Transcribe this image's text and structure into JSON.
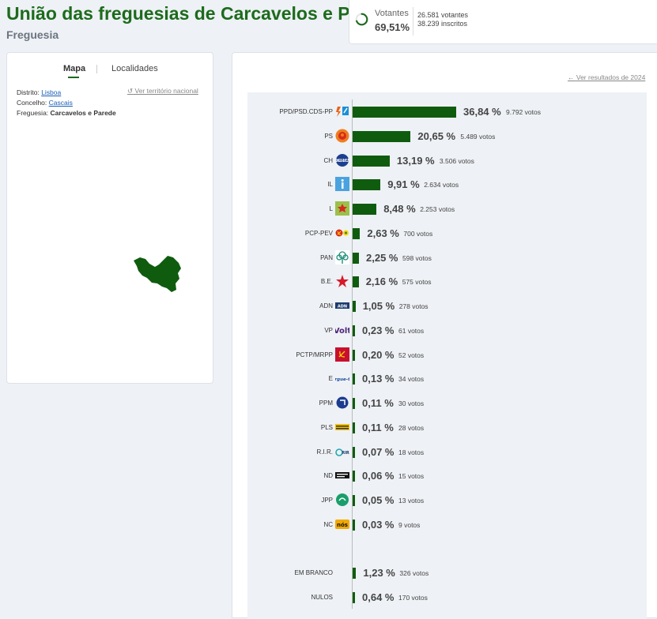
{
  "header": {
    "title": "União das freguesias de Carcavelos e Parede",
    "subtitle": "Freguesia"
  },
  "turnout": {
    "label": "Votantes",
    "percent": "69,51%",
    "percent_value": 69.51,
    "voters": "26.581 votantes",
    "registered": "38.239 inscritos"
  },
  "left_panel": {
    "tabs": [
      {
        "label": "Mapa"
      },
      {
        "label": "Localidades"
      }
    ],
    "distrito_label": "Distrito:",
    "distrito_value": "Lisboa",
    "concelho_label": "Concelho:",
    "concelho_value": "Cascais",
    "freguesia_label": "Freguesia:",
    "freguesia_value": "Carcavelos e Parede",
    "ver_territorio": "Ver território nacional",
    "map_color": "#0f5c0f"
  },
  "results": {
    "ver_resultados": "Ver resultados de 2024",
    "bar_color": "#0f5c0f",
    "parties": [
      {
        "name": "PPD/PSD.CDS-PP",
        "pct": "36,84 %",
        "value": 36.84,
        "votes": "9.792 votos",
        "logo": "psd-cds-logo"
      },
      {
        "name": "PS",
        "pct": "20,65 %",
        "value": 20.65,
        "votes": "5.489 votos",
        "logo": "ps-logo"
      },
      {
        "name": "CH",
        "pct": "13,19 %",
        "value": 13.19,
        "votes": "3.506 votos",
        "logo": "ch-logo"
      },
      {
        "name": "IL",
        "pct": "9,91 %",
        "value": 9.91,
        "votes": "2.634 votos",
        "logo": "il-logo"
      },
      {
        "name": "L",
        "pct": "8,48 %",
        "value": 8.48,
        "votes": "2.253 votos",
        "logo": "livre-logo"
      },
      {
        "name": "PCP-PEV",
        "pct": "2,63 %",
        "value": 2.63,
        "votes": "700 votos",
        "logo": "pcp-pev-logo"
      },
      {
        "name": "PAN",
        "pct": "2,25 %",
        "value": 2.25,
        "votes": "598 votos",
        "logo": "pan-logo"
      },
      {
        "name": "B.E.",
        "pct": "2,16 %",
        "value": 2.16,
        "votes": "575 votos",
        "logo": "be-logo"
      },
      {
        "name": "ADN",
        "pct": "1,05 %",
        "value": 1.05,
        "votes": "278 votos",
        "logo": "adn-logo"
      },
      {
        "name": "VP",
        "pct": "0,23 %",
        "value": 0.23,
        "votes": "61 votos",
        "logo": "volt-logo"
      },
      {
        "name": "PCTP/MRPP",
        "pct": "0,20 %",
        "value": 0.2,
        "votes": "52 votos",
        "logo": "pctp-logo"
      },
      {
        "name": "E",
        "pct": "0,13 %",
        "value": 0.13,
        "votes": "34 votos",
        "logo": "ergue-te-logo"
      },
      {
        "name": "PPM",
        "pct": "0,11 %",
        "value": 0.11,
        "votes": "30 votos",
        "logo": "ppm-logo"
      },
      {
        "name": "PLS",
        "pct": "0,11 %",
        "value": 0.11,
        "votes": "28 votos",
        "logo": "pls-logo"
      },
      {
        "name": "R.I.R.",
        "pct": "0,07 %",
        "value": 0.07,
        "votes": "18 votos",
        "logo": "rir-logo"
      },
      {
        "name": "ND",
        "pct": "0,06 %",
        "value": 0.06,
        "votes": "15 votos",
        "logo": "nd-logo"
      },
      {
        "name": "JPP",
        "pct": "0,05 %",
        "value": 0.05,
        "votes": "13 votos",
        "logo": "jpp-logo"
      },
      {
        "name": "NC",
        "pct": "0,03 %",
        "value": 0.03,
        "votes": "9 votos",
        "logo": "nc-logo"
      }
    ],
    "others": [
      {
        "name": "EM BRANCO",
        "pct": "1,23 %",
        "value": 1.23,
        "votes": "326 votos"
      },
      {
        "name": "NULOS",
        "pct": "0,64 %",
        "value": 0.64,
        "votes": "170 votos"
      }
    ]
  },
  "chart_data": {
    "type": "bar",
    "categories": [
      "PPD/PSD.CDS-PP",
      "PS",
      "CH",
      "IL",
      "L",
      "PCP-PEV",
      "PAN",
      "B.E.",
      "ADN",
      "VP",
      "PCTP/MRPP",
      "E",
      "PPM",
      "PLS",
      "R.I.R.",
      "ND",
      "JPP",
      "NC",
      "EM BRANCO",
      "NULOS"
    ],
    "values": [
      36.84,
      20.65,
      13.19,
      9.91,
      8.48,
      2.63,
      2.25,
      2.16,
      1.05,
      0.23,
      0.2,
      0.13,
      0.11,
      0.11,
      0.07,
      0.06,
      0.05,
      0.03,
      1.23,
      0.64
    ],
    "votes": [
      9792,
      5489,
      3506,
      2634,
      2253,
      700,
      598,
      575,
      278,
      61,
      52,
      34,
      30,
      28,
      18,
      15,
      13,
      9,
      326,
      170
    ]
  }
}
